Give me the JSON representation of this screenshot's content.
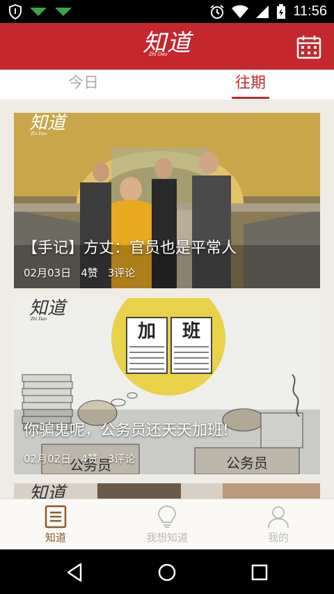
{
  "status_bar": {
    "time": "11:56",
    "icons": [
      "shield-icon",
      "signal-green-icon",
      "signal-green-icon",
      "alarm-icon",
      "wifi-icon",
      "cell-signal-icon",
      "battery-charging-icon"
    ]
  },
  "header": {
    "logo_text": "知道",
    "logo_sub": "Zhi Dao",
    "calendar_icon": "calendar-icon",
    "brand_color": "#c4282d"
  },
  "tabs": [
    {
      "label": "今日",
      "active": false
    },
    {
      "label": "往期",
      "active": true
    }
  ],
  "cards": [
    {
      "logo_text": "知道",
      "logo_sub": "Zhi Dao",
      "title": "【手记】方丈：官员也是平常人",
      "date": "02月03日",
      "likes": "4赞",
      "comments": "3评论"
    },
    {
      "logo_text": "知道",
      "logo_sub": "Zhi Dao",
      "title": "你骗鬼呢，公务员还天天加班!",
      "date": "02月02日",
      "likes": "4赞",
      "comments": "3评论",
      "cartoon_text": [
        "加",
        "班",
        "公务员",
        "公务员"
      ]
    },
    {
      "logo_text": "知道"
    }
  ],
  "bottom_nav": [
    {
      "label": "知道",
      "icon": "document-icon",
      "active": true
    },
    {
      "label": "我想知道",
      "icon": "lightbulb-icon",
      "active": false
    },
    {
      "label": "我的",
      "icon": "person-icon",
      "active": false
    }
  ],
  "system_nav": [
    "back-icon",
    "home-icon",
    "recents-icon"
  ]
}
